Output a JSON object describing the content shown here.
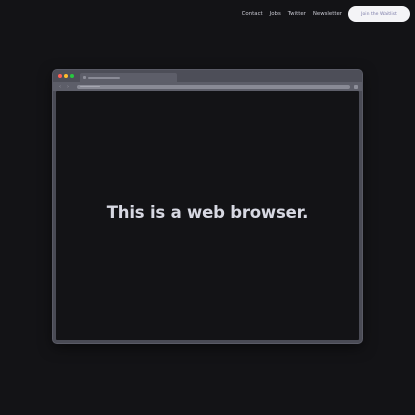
{
  "nav": {
    "links": [
      "Contact",
      "Jobs",
      "Twitter",
      "Newsletter"
    ],
    "cta_label": "Join the Waitlist"
  },
  "browser": {
    "window_controls": [
      "close",
      "minimize",
      "maximize"
    ],
    "viewport_text": "This is a web browser."
  },
  "colors": {
    "background": "#131316",
    "frame": "#4a4b55",
    "cta_bg": "#f4f4f7",
    "cta_text": "#7c7ca8"
  }
}
